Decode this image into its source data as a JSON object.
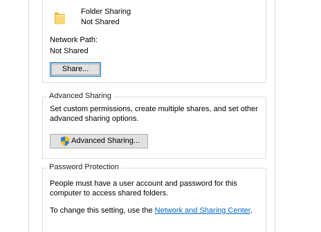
{
  "sharing": {
    "folder_name": "Folder Sharing",
    "folder_status": "Not Shared",
    "network_path_label": "Network Path:",
    "network_path_value": "Not Shared",
    "share_button": "Share...",
    "folder_icon": "folder-icon"
  },
  "advanced": {
    "title": "Advanced Sharing",
    "desc_line1": "Set custom permissions, create multiple shares, and set other",
    "desc_line2": "advanced sharing options.",
    "button_label": "Advanced Sharing...",
    "button_icon": "uac-shield-icon"
  },
  "password": {
    "title": "Password Protection",
    "desc_line1": "People must have a user account and password for this",
    "desc_line2": "computer to access shared folders.",
    "change_prefix": "To change this setting, use the ",
    "link_text": "Network and Sharing Center",
    "change_suffix": "."
  },
  "colors": {
    "link": "#0066cc",
    "focus_border": "#0078d7",
    "button_face": "#e1e1e1",
    "group_border": "#dcdcdc"
  }
}
